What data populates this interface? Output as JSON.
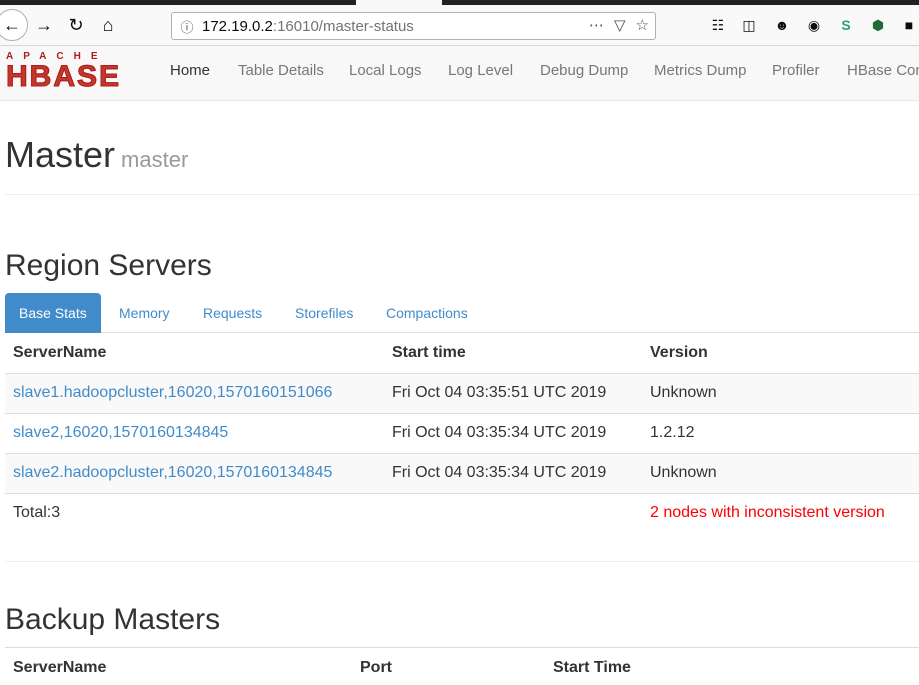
{
  "browser": {
    "url_host": "172.19.0.2",
    "url_path": ":16010/master-status"
  },
  "nav": {
    "logo_top": "APACHE",
    "logo_main": "HBASE",
    "items": [
      "Home",
      "Table Details",
      "Local Logs",
      "Log Level",
      "Debug Dump",
      "Metrics Dump",
      "Profiler",
      "HBase Con"
    ]
  },
  "header": {
    "title": "Master",
    "subtitle": "master"
  },
  "region_servers": {
    "title": "Region Servers",
    "tabs": [
      "Base Stats",
      "Memory",
      "Requests",
      "Storefiles",
      "Compactions"
    ],
    "columns": [
      "ServerName",
      "Start time",
      "Version"
    ],
    "rows": [
      {
        "server": "slave1.hadoopcluster,16020,1570160151066",
        "start": "Fri Oct 04 03:35:51 UTC 2019",
        "version": "Unknown"
      },
      {
        "server": "slave2,16020,1570160134845",
        "start": "Fri Oct 04 03:35:34 UTC 2019",
        "version": "1.2.12"
      },
      {
        "server": "slave2.hadoopcluster,16020,1570160134845",
        "start": "Fri Oct 04 03:35:34 UTC 2019",
        "version": "Unknown"
      }
    ],
    "total": "Total:3",
    "warning": "2 nodes with inconsistent version"
  },
  "backup_masters": {
    "title": "Backup Masters",
    "columns": [
      "ServerName",
      "Port",
      "Start Time"
    ]
  }
}
